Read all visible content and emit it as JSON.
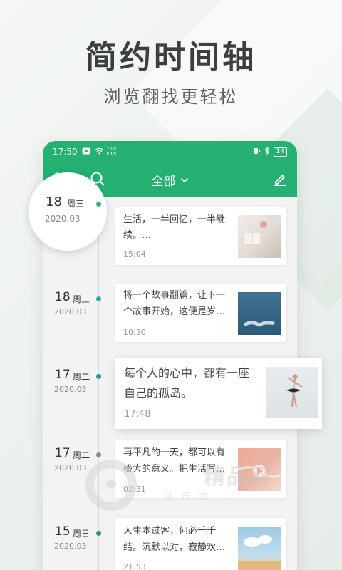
{
  "promo": {
    "headline": "简约时间轴",
    "subhead": "浏览翻找更轻松"
  },
  "status_bar": {
    "time": "17:50",
    "net_speed_value": "7.00",
    "net_speed_unit": "KB/S",
    "battery": "14",
    "icons": [
      "notification-icon",
      "wifi-icon",
      "vibrate-icon",
      "bluetooth-icon",
      "battery-icon"
    ]
  },
  "app_bar": {
    "filter_label": "全部",
    "icons": [
      "calendar-icon",
      "search-icon",
      "chevron-down-icon",
      "edit-icon"
    ]
  },
  "entries": [
    {
      "day": "18",
      "weekday": "周三",
      "year_month": "2020.03",
      "line1": "生活，一半回忆，一半继",
      "line2": "续。…",
      "time": "15:04",
      "dot_color": "#2eb872"
    },
    {
      "day": "18",
      "weekday": "周三",
      "year_month": "2020.03",
      "line1": "将一个故事翻篇，让下一",
      "line2": "个故事开始，这便是岁…",
      "time": "10:30",
      "dot_color": "#2aa8a8"
    },
    {
      "day": "17",
      "weekday": "周二",
      "year_month": "2020.03",
      "line1": "每个人的心中，都有一座",
      "line2": "自己的孤岛。",
      "time": "17:48",
      "dot_color": "#2a9a96"
    },
    {
      "day": "17",
      "weekday": "周二",
      "year_month": "2020.03",
      "line1": "再平凡的一天，都可以有",
      "line2": "盛大的意义。把生活写…",
      "time": "02:31",
      "dot_color": "#888888"
    },
    {
      "day": "15",
      "weekday": "周日",
      "year_month": "2020.03",
      "line1": "人生本过客，何必千千",
      "line2": "结。沉默以对，寂静欢…",
      "time": "21:53",
      "dot_color": "#2a8f8a"
    }
  ],
  "watermark": {
    "main": "精品网",
    "sub": "排 行 榜"
  }
}
